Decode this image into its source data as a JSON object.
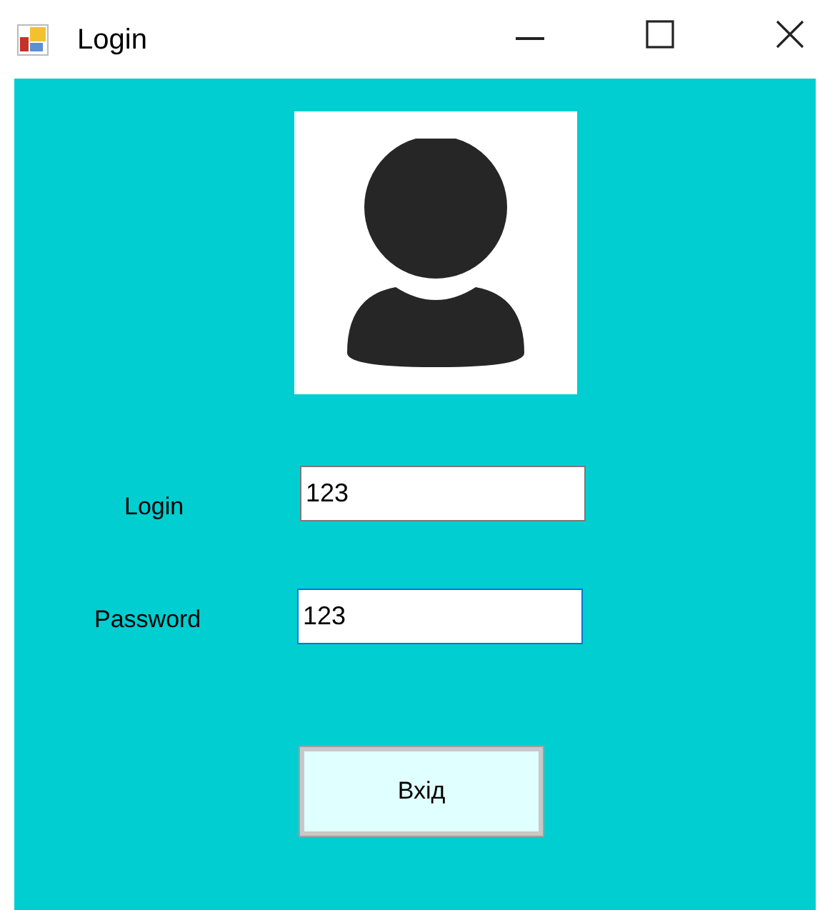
{
  "window": {
    "title": "Login"
  },
  "fields": [
    {
      "label": "Login",
      "value": "123",
      "focused": false
    },
    {
      "label": "Password",
      "value": "123",
      "focused": true
    }
  ],
  "button": {
    "label": "Вхід"
  }
}
